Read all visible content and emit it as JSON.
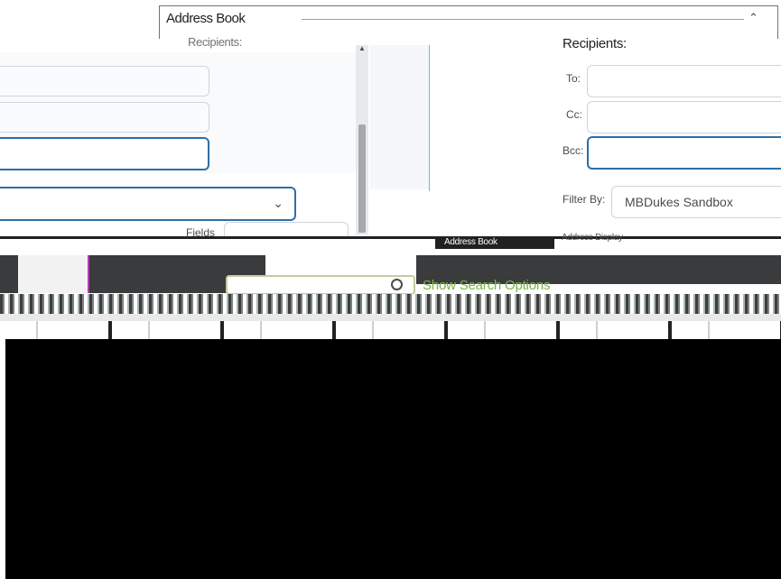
{
  "dialog": {
    "title": "Address Book",
    "collapse_icon": "chevron-up-icon",
    "recipients_left_label": "Recipients:"
  },
  "left": {
    "inputs": [
      "",
      "",
      ""
    ],
    "select_value": "",
    "select_icon": "chevron-down-icon"
  },
  "recipients": {
    "heading": "Recipients:",
    "to_label": "To:",
    "cc_label": "Cc:",
    "bcc_label": "Bcc:",
    "to_value": "",
    "cc_value": "",
    "bcc_value": ""
  },
  "filter": {
    "label": "Filter By:",
    "value": "MBDukes Sandbox"
  },
  "band": {
    "fields_label": "Fields",
    "address_book_chip": "Address Book",
    "right_text": "Address Display",
    "show_search_options": "Show Search Options"
  },
  "colors": {
    "focus_border": "#2e6ea5",
    "link_green": "#7bb24a",
    "accent_cyan": "#52c7e6"
  }
}
